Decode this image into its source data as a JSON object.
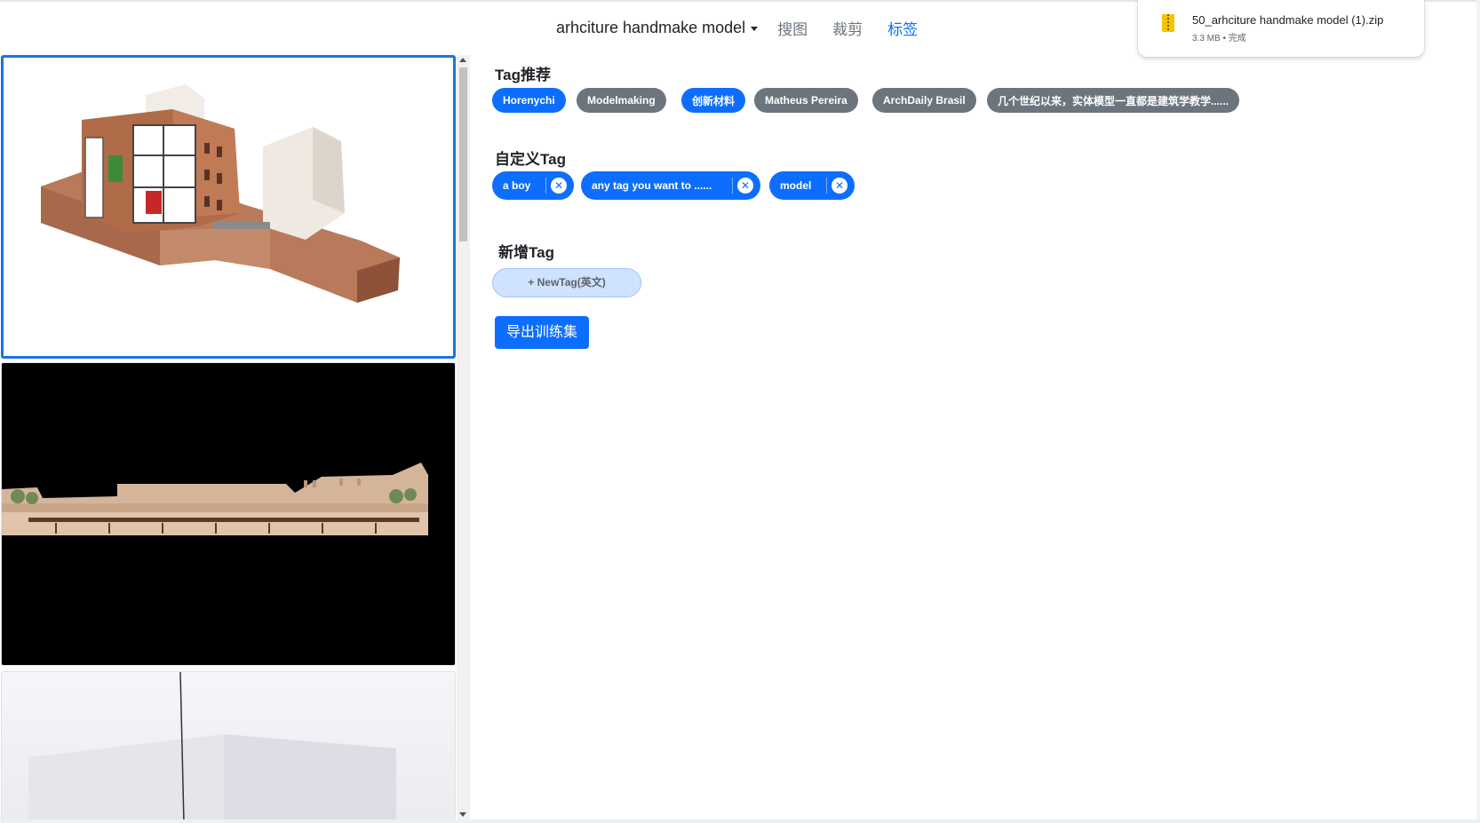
{
  "nav": {
    "dataset_label": "arhciture handmake model",
    "links": [
      {
        "label": "搜图",
        "active": false
      },
      {
        "label": "裁剪",
        "active": false
      },
      {
        "label": "标签",
        "active": true
      }
    ]
  },
  "download": {
    "filename": "50_arhciture handmake model (1).zip",
    "meta": "3.3 MB • 完成",
    "icon": "zip-file-icon"
  },
  "gallery": {
    "images": [
      {
        "name": "cutaway-building-model",
        "selected": true
      },
      {
        "name": "facade-elevation-model",
        "selected": false
      },
      {
        "name": "acrylic-box-model",
        "selected": false
      }
    ]
  },
  "tags": {
    "recommended_title": "Tag推荐",
    "recommended": [
      {
        "label": "Horenychi",
        "style": "blue"
      },
      {
        "label": "Modelmaking",
        "style": "gray"
      },
      {
        "label": "创新材料",
        "style": "blue"
      },
      {
        "label": "Matheus Pereira",
        "style": "gray"
      },
      {
        "label": "ArchDaily Brasil",
        "style": "gray"
      },
      {
        "label": "几个世纪以来，实体模型一直都是建筑学教学......",
        "style": "gray"
      }
    ],
    "custom_title": "自定义Tag",
    "custom": [
      {
        "label": "a boy"
      },
      {
        "label": "any tag you want to ......"
      },
      {
        "label": "model"
      }
    ],
    "new_title": "新增Tag",
    "new_placeholder": "+ NewTag(英文)"
  },
  "actions": {
    "export_label": "导出训练集"
  },
  "colors": {
    "primary": "#0d6efd",
    "secondary": "#6c757d",
    "selected_border": "#1a73e8"
  }
}
